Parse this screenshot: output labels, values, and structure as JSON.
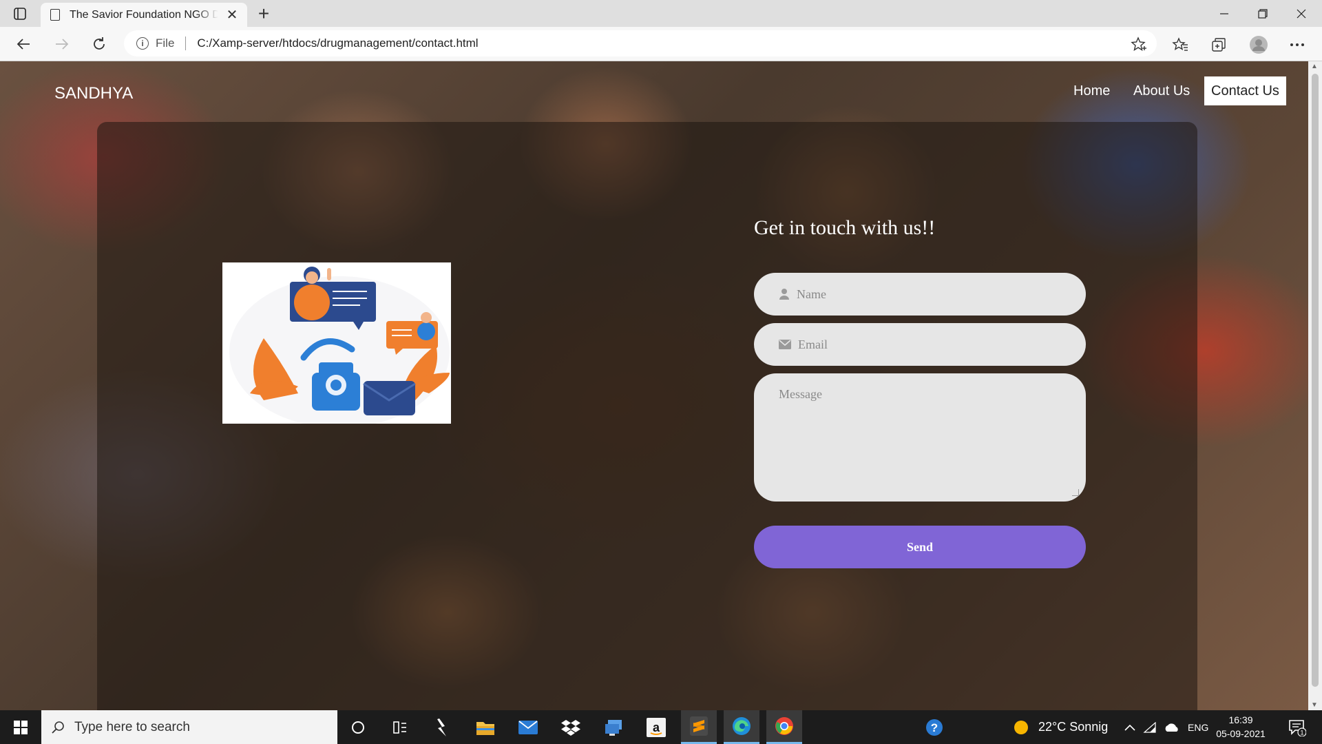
{
  "browser": {
    "tab_title": "The Savior Foundation NGO Donation",
    "url_scheme": "File",
    "url": "C:/Xamp-server/htdocs/drugmanagement/contact.html"
  },
  "site": {
    "brand": "SANDHYA",
    "nav": [
      {
        "label": "Home",
        "active": false
      },
      {
        "label": "About Us",
        "active": false
      },
      {
        "label": "Contact Us",
        "active": true
      }
    ]
  },
  "contact_form": {
    "title": "Get in touch with us!!",
    "name_placeholder": "Name",
    "email_placeholder": "Email",
    "message_placeholder": "Message",
    "send_label": "Send",
    "accent_color": "#8065d6"
  },
  "taskbar": {
    "search_placeholder": "Type here to search",
    "weather": "22°C  Sonnig",
    "language": "ENG",
    "time": "16:39",
    "date": "05-09-2021",
    "notifications": "1"
  }
}
